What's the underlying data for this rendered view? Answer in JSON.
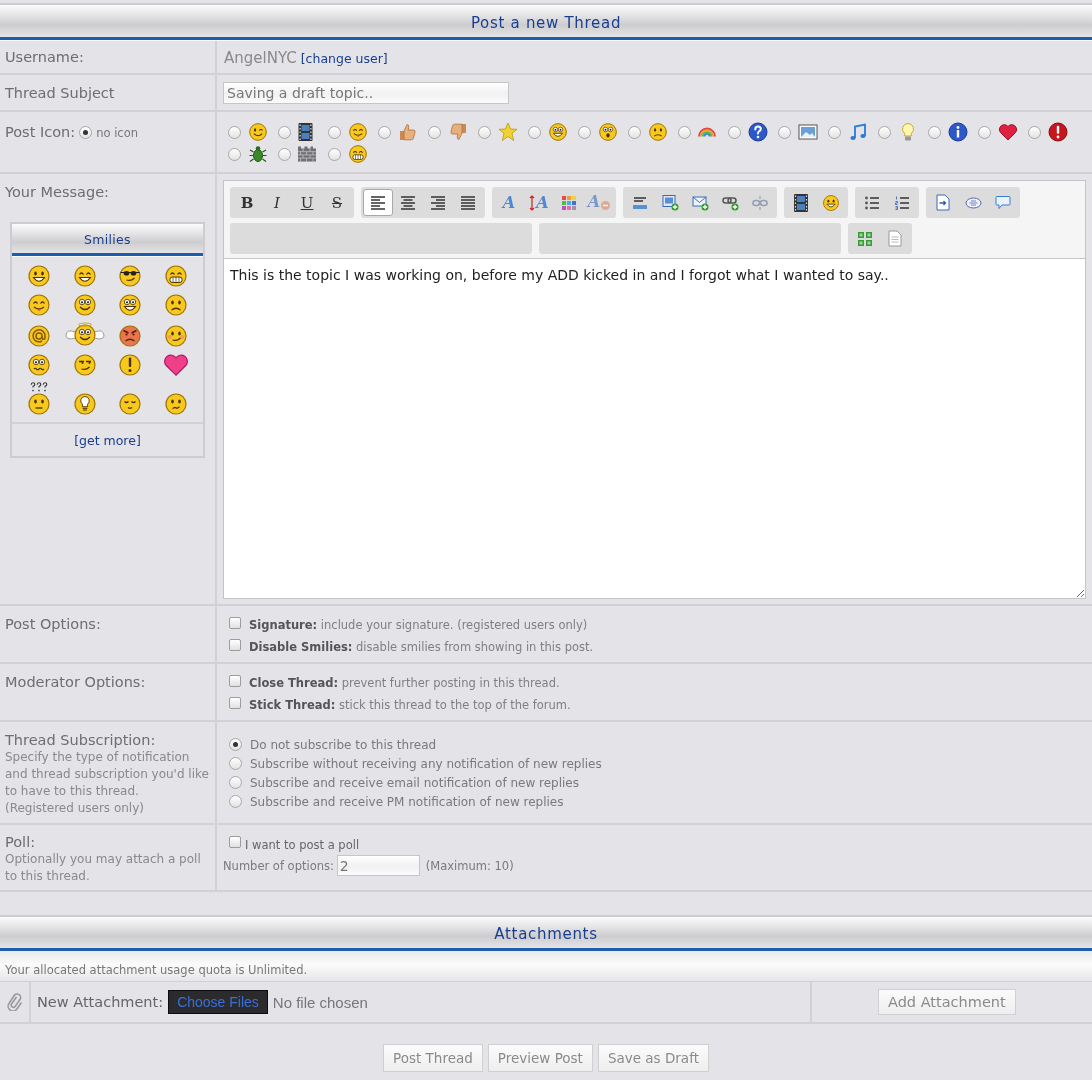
{
  "header": {
    "title": "Post a new Thread"
  },
  "username": {
    "label": "Username:",
    "value": "AngelNYC",
    "link": "[change user]"
  },
  "subject": {
    "label": "Thread Subject",
    "value": "Saving a draft topic.."
  },
  "post_icon": {
    "label": "Post Icon:",
    "no_icon": {
      "label": "no icon",
      "selected": true
    },
    "icons": [
      {
        "kind": "wink",
        "selected": false
      },
      {
        "kind": "film",
        "selected": false
      },
      {
        "kind": "tongue",
        "selected": false
      },
      {
        "kind": "thumbs-up",
        "selected": false
      },
      {
        "kind": "thumbs-down",
        "selected": false
      },
      {
        "kind": "star",
        "selected": false
      },
      {
        "kind": "goofy",
        "selected": false
      },
      {
        "kind": "surprised",
        "selected": false
      },
      {
        "kind": "sad",
        "selected": false
      },
      {
        "kind": "rainbow",
        "selected": false
      },
      {
        "kind": "question",
        "selected": false
      },
      {
        "kind": "picture",
        "selected": false
      },
      {
        "kind": "music",
        "selected": false
      },
      {
        "kind": "lightbulb",
        "selected": false
      },
      {
        "kind": "info",
        "selected": false
      },
      {
        "kind": "heart",
        "selected": false
      },
      {
        "kind": "exclamation",
        "selected": false
      },
      {
        "kind": "bug",
        "selected": false
      },
      {
        "kind": "wall",
        "selected": false
      },
      {
        "kind": "grin",
        "selected": false
      }
    ]
  },
  "message": {
    "label": "Your Message:",
    "smilies": {
      "title": "Smilies",
      "items": [
        {
          "kind": "smile"
        },
        {
          "kind": "laugh"
        },
        {
          "kind": "cool"
        },
        {
          "kind": "biggrin"
        },
        {
          "kind": "tongue"
        },
        {
          "kind": "rolleyes"
        },
        {
          "kind": "goofy"
        },
        {
          "kind": "frown"
        },
        {
          "kind": "at"
        },
        {
          "kind": "angel"
        },
        {
          "kind": "mad"
        },
        {
          "kind": "blush"
        },
        {
          "kind": "dizzy"
        },
        {
          "kind": "shifty"
        },
        {
          "kind": "alert"
        },
        {
          "kind": "love"
        },
        {
          "kind": "puzzled"
        },
        {
          "kind": "idea"
        },
        {
          "kind": "sleepy"
        },
        {
          "kind": "unsure"
        }
      ],
      "more_link": "[get more]"
    },
    "toolbar_rows": [
      [
        {
          "kind": "group",
          "buttons": [
            {
              "kind": "bold",
              "label": "B",
              "selected": false,
              "disabled": false
            },
            {
              "kind": "italic",
              "label": "I",
              "selected": false,
              "disabled": false
            },
            {
              "kind": "underline",
              "label": "U",
              "selected": false,
              "disabled": false
            },
            {
              "kind": "strike",
              "label": "S",
              "selected": false,
              "disabled": false
            }
          ]
        },
        {
          "kind": "group",
          "buttons": [
            {
              "kind": "align-left",
              "selected": true,
              "disabled": false
            },
            {
              "kind": "align-center",
              "selected": false,
              "disabled": false
            },
            {
              "kind": "align-right",
              "selected": false,
              "disabled": false
            },
            {
              "kind": "justify",
              "selected": false,
              "disabled": false
            }
          ]
        },
        {
          "kind": "group",
          "buttons": [
            {
              "kind": "font",
              "label": "A",
              "selected": false,
              "disabled": false
            },
            {
              "kind": "size",
              "label": "A",
              "selected": false,
              "disabled": false
            },
            {
              "kind": "color",
              "selected": false,
              "disabled": false
            },
            {
              "kind": "remove-format",
              "label": "A",
              "selected": false,
              "disabled": true
            }
          ]
        },
        {
          "kind": "group",
          "buttons": [
            {
              "kind": "hr",
              "selected": false,
              "disabled": false
            },
            {
              "kind": "image",
              "selected": false,
              "disabled": false
            },
            {
              "kind": "email",
              "selected": false,
              "disabled": false
            },
            {
              "kind": "link",
              "selected": false,
              "disabled": false
            },
            {
              "kind": "unlink",
              "selected": false,
              "disabled": true
            }
          ]
        },
        {
          "kind": "group",
          "buttons": [
            {
              "kind": "video",
              "selected": false,
              "disabled": false
            },
            {
              "kind": "smiley",
              "selected": false,
              "disabled": false
            }
          ]
        },
        {
          "kind": "group",
          "buttons": [
            {
              "kind": "bullets",
              "selected": false,
              "disabled": false
            },
            {
              "kind": "numbers",
              "selected": false,
              "disabled": false
            }
          ]
        },
        {
          "kind": "group",
          "buttons": [
            {
              "kind": "code",
              "selected": false,
              "disabled": false
            },
            {
              "kind": "script",
              "selected": false,
              "disabled": false
            },
            {
              "kind": "quote",
              "selected": false,
              "disabled": false
            }
          ]
        }
      ],
      [
        {
          "kind": "dropdown"
        },
        {
          "kind": "dropdown"
        },
        {
          "kind": "group",
          "buttons": [
            {
              "kind": "maximize",
              "selected": false,
              "disabled": false
            },
            {
              "kind": "page",
              "selected": false,
              "disabled": false
            }
          ]
        }
      ]
    ],
    "body": "This is the topic I was working on, before my ADD kicked in and I forgot what I wanted to say.."
  },
  "post_options": {
    "label": "Post Options:",
    "options": [
      {
        "text": "**Signature:** include your signature. (registered users only)",
        "checked": false
      },
      {
        "text": "**Disable Smilies:** disable smilies from showing in this post.",
        "checked": false
      }
    ]
  },
  "moderator_options": {
    "label": "Moderator Options:",
    "options": [
      {
        "text": "**Close Thread:** prevent further posting in this thread.",
        "checked": false
      },
      {
        "text": "**Stick Thread:** stick this thread to the top of the forum.",
        "checked": false
      }
    ]
  },
  "subscription": {
    "label": "Thread Subscription:",
    "description": "Specify the type of notification and thread subscription you'd like to have to this thread.",
    "note": "(Registered users only)",
    "choices": [
      {
        "label": "Do not subscribe to this thread",
        "selected": true
      },
      {
        "label": "Subscribe without receiving any notification of new replies",
        "selected": false
      },
      {
        "label": "Subscribe and receive email notification of new replies",
        "selected": false
      },
      {
        "label": "Subscribe and receive PM notification of new replies",
        "selected": false
      }
    ]
  },
  "poll": {
    "label": "Poll:",
    "description": "Optionally you may attach a poll to this thread.",
    "checkbox": {
      "label": "I want to post a poll",
      "checked": false
    },
    "count_label": "Number of options:",
    "count_value": "2",
    "max_note": "(Maximum: 10)"
  },
  "attachments": {
    "title": "Attachments",
    "quota": "Your allocated attachment usage quota is Unlimited.",
    "label": "New Attachment:",
    "choose_button": "Choose Files",
    "file_status": "No file chosen",
    "add_button": "Add Attachment"
  },
  "actions": [
    "Post Thread",
    "Preview Post",
    "Save as Draft"
  ]
}
